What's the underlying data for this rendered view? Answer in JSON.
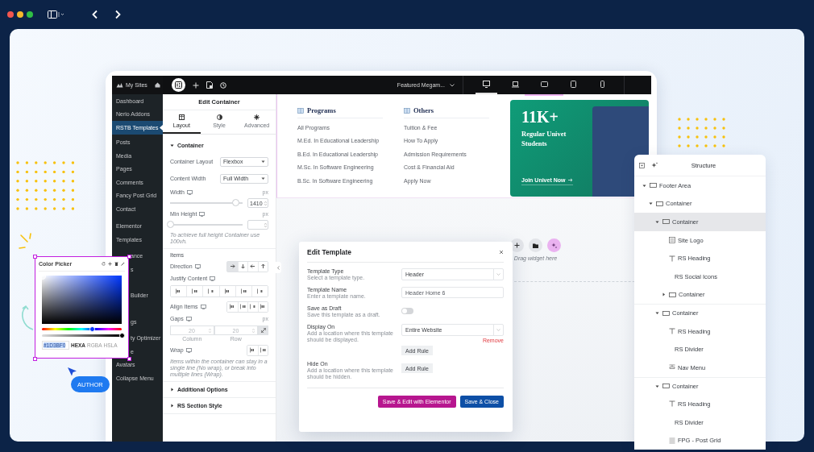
{
  "wp_menu": {
    "site": "My Sites",
    "groups": [
      [
        {
          "label": "Dashboard",
          "kind": "item",
          "selected": false
        },
        {
          "label": "Nerio Addons",
          "kind": "item",
          "selected": false
        },
        {
          "label": "RSTB Templates",
          "kind": "item",
          "selected": true
        }
      ],
      [
        {
          "label": "Posts",
          "kind": "item",
          "selected": false
        },
        {
          "label": "Media",
          "kind": "item",
          "selected": false
        },
        {
          "label": "Pages",
          "kind": "item",
          "selected": false
        },
        {
          "label": "Comments",
          "kind": "item",
          "selected": false
        },
        {
          "label": "Fancy Post Grid",
          "kind": "item",
          "selected": false
        },
        {
          "label": "Contact",
          "kind": "item",
          "selected": false
        }
      ],
      [
        {
          "label": "Elementor",
          "kind": "item",
          "selected": false
        },
        {
          "label": "Templates",
          "kind": "item",
          "selected": false
        }
      ],
      [
        {
          "label": "ance",
          "kind": "cut",
          "selected": false
        },
        {
          "label": "s",
          "kind": "cut",
          "selected": false
        },
        {
          "label": "Builder",
          "kind": "cut",
          "selected": false
        },
        {
          "label": "gs",
          "kind": "cut",
          "selected": false
        },
        {
          "label": "ty Optimizer",
          "kind": "cut",
          "selected": false
        },
        {
          "label": "e",
          "kind": "cut",
          "selected": false
        },
        {
          "label": "Avatars",
          "kind": "item",
          "selected": false
        },
        {
          "label": "Collapse Menu",
          "kind": "item",
          "selected": false
        }
      ]
    ]
  },
  "editor_bar": {
    "document": "Featured Megam...",
    "devices": [
      {
        "kind": "desktop",
        "selected": true
      },
      {
        "kind": "laptop",
        "selected": false
      },
      {
        "kind": "landscape",
        "selected": false
      },
      {
        "kind": "tablet",
        "selected": false
      },
      {
        "kind": "mobile",
        "selected": false
      }
    ]
  },
  "edit_panel": {
    "title": "Edit Container",
    "tabs": [
      {
        "label": "Layout",
        "kind": "layout",
        "selected": true
      },
      {
        "label": "Style",
        "kind": "style",
        "selected": false
      },
      {
        "label": "Advanced",
        "kind": "advanced",
        "selected": false
      }
    ],
    "sections": [
      {
        "title": "Container",
        "expanded": true,
        "controls": [
          {
            "kind": "select",
            "label": "Container Layout",
            "value": "Flexbox",
            "responsive": false
          },
          {
            "kind": "select",
            "label": "Content Width",
            "value": "Full Width",
            "responsive": false
          },
          {
            "kind": "slider",
            "label": "Width",
            "responsive": true,
            "unit": "px",
            "level": 0.9,
            "value": "1410"
          },
          {
            "kind": "slider",
            "label": "Min Height",
            "responsive": true,
            "unit": "px",
            "level": 0
          },
          {
            "kind": "note",
            "text": "To achieve full height Container use 100vh."
          },
          {
            "kind": "heading",
            "text": "Items"
          },
          {
            "kind": "direction",
            "label": "Direction",
            "responsive": true,
            "options": [
              {
                "selected": true
              },
              {
                "selected": false
              },
              {
                "selected": false
              },
              {
                "selected": false
              }
            ]
          },
          {
            "kind": "buttonbar",
            "label": "Justify Content",
            "responsive": true,
            "options": [
              {
                "selected": false
              },
              {
                "selected": false
              },
              {
                "selected": false
              },
              {
                "selected": false
              },
              {
                "selected": false
              },
              {
                "selected": false
              }
            ]
          },
          {
            "kind": "buttons",
            "label": "Align Items",
            "responsive": true,
            "options": [
              {
                "selected": false
              },
              {
                "selected": false
              },
              {
                "selected": false
              },
              {
                "selected": false
              }
            ]
          },
          {
            "kind": "gaps",
            "label": "Gaps",
            "responsive": true,
            "unit": "px",
            "linked": true,
            "fields": [
              {
                "placeholder": "20",
                "caption": "Column"
              },
              {
                "placeholder": "20",
                "caption": "Row"
              }
            ]
          },
          {
            "kind": "buttons",
            "label": "Wrap",
            "responsive": true,
            "options": [
              {
                "selected": false
              },
              {
                "selected": false
              }
            ]
          },
          {
            "kind": "note",
            "text": "Items within the container can stay in a single line (No wrap), or break into multiple lines (Wrap)."
          }
        ]
      },
      {
        "title": "Additional Options",
        "expanded": false
      },
      {
        "title": "RS Section Style",
        "expanded": false
      }
    ]
  },
  "mega_menu": {
    "columns": [
      {
        "title": "Programs",
        "links": [
          "All Programs",
          "M.Ed. In Educational Leadership",
          "B.Ed. In Educational Leadership",
          "M.Sc. In Software Engineering",
          "B.Sc. In Software Engineering"
        ]
      },
      {
        "title": "Others",
        "links": [
          "Tuition & Fee",
          "How To Apply",
          "Admission Requirements",
          "Cost & Financial Aid",
          "Apply Now"
        ]
      }
    ],
    "promo": {
      "stat": "11K+",
      "text": "Regular Univet Students",
      "cta": "Join Univet Now"
    }
  },
  "drop_zone": {
    "hint": "Drag widget here"
  },
  "template_dialog": {
    "title": "Edit Template",
    "rows": [
      {
        "kind": "select",
        "label": "Template Type",
        "help": "Select a template type.",
        "value": "Header"
      },
      {
        "kind": "input",
        "label": "Template Name",
        "help": "Enter a template name.",
        "value": "Header Home 6"
      },
      {
        "kind": "toggle",
        "label": "Save as Draft",
        "help": "Save this template as a draft.",
        "on": false
      },
      {
        "kind": "rule",
        "label": "Display On",
        "help": "Add a location where this template should be displayed.",
        "value": "Entire Website",
        "remove": "Remove",
        "add": "Add Rule"
      },
      {
        "kind": "rule",
        "label": "Hide On",
        "help": "Add a location where this template should be hidden.",
        "add": "Add Rule"
      }
    ],
    "buttons": [
      {
        "label": "Save & Edit with Elementor",
        "kind": "accent"
      },
      {
        "label": "Save & Close",
        "kind": "primary"
      }
    ]
  },
  "structure": {
    "title": "Structure",
    "tree": [
      {
        "label": "Footer Area",
        "kind": "container",
        "expanded": true,
        "selected": false,
        "children": [
          {
            "label": "Container",
            "kind": "container",
            "expanded": true,
            "selected": false,
            "children": [
              {
                "label": "Container",
                "kind": "container",
                "expanded": true,
                "selected": true,
                "children": [
                  {
                    "label": "Site Logo",
                    "kind": "logo",
                    "selected": false
                  },
                  {
                    "label": "RS Heading",
                    "kind": "heading",
                    "selected": false
                  },
                  {
                    "label": "RS Social Icons",
                    "kind": "plain",
                    "selected": false
                  },
                  {
                    "label": "Container",
                    "kind": "container",
                    "expanded": false,
                    "selected": false
                  }
                ]
              },
              {
                "label": "Container",
                "kind": "container",
                "expanded": true,
                "selected": false,
                "children": [
                  {
                    "label": "RS Heading",
                    "kind": "heading",
                    "selected": false
                  },
                  {
                    "label": "RS Divider",
                    "kind": "plain",
                    "selected": false
                  },
                  {
                    "label": "Nav Menu",
                    "kind": "menu",
                    "selected": false
                  }
                ]
              },
              {
                "label": "Container",
                "kind": "container",
                "expanded": true,
                "selected": false,
                "children": [
                  {
                    "label": "RS Heading",
                    "kind": "heading",
                    "selected": false
                  },
                  {
                    "label": "RS Divider",
                    "kind": "plain",
                    "selected": false
                  },
                  {
                    "label": "FPG - Post Grid",
                    "kind": "grid",
                    "selected": false
                  }
                ]
              }
            ]
          }
        ]
      }
    ]
  },
  "color_picker": {
    "title": "Color Picker",
    "hue": {
      "level": 0.63
    },
    "alpha": {
      "level": 1
    },
    "hex": "#1D3BF0",
    "formats": [
      {
        "label": "HEXA",
        "selected": true
      },
      {
        "label": "RGBA",
        "selected": false
      },
      {
        "label": "HSLA",
        "selected": false
      }
    ]
  },
  "badge": {
    "label": "AUTHOR"
  }
}
